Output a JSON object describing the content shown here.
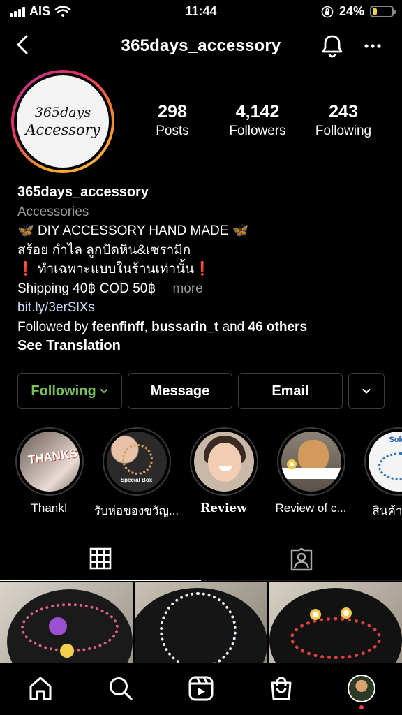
{
  "status_bar": {
    "carrier": "AIS",
    "time": "11:44",
    "battery_percent": "24%",
    "battery_level": 0.24,
    "icons": [
      "signal-icon",
      "wifi-icon",
      "orientation-lock-icon",
      "battery-icon"
    ]
  },
  "header": {
    "title": "365days_accessory",
    "icons": [
      "back-arrow-icon",
      "bell-icon",
      "more-dots-icon"
    ]
  },
  "profile": {
    "avatar_line1": "365days",
    "avatar_line2": "Accessory",
    "stats": [
      {
        "value": "298",
        "label": "Posts"
      },
      {
        "value": "4,142",
        "label": "Followers"
      },
      {
        "value": "243",
        "label": "Following"
      }
    ]
  },
  "bio": {
    "name": "365days_accessory",
    "category": "Accessories",
    "line1": "DIY ACCESSORY HAND MADE",
    "line2": "สร้อย กำไล ลูกปัดหิน&เซรามิก",
    "line3": "ทำเฉพาะแบบในร้านเท่านั้น",
    "line4": "Shipping 40฿ COD 50฿",
    "more": "more",
    "link": "bit.ly/3erSlXs",
    "followed_by_prefix": "Followed by ",
    "followed_user1": "feenfinff",
    "followed_sep": ", ",
    "followed_user2": "bussarin_t",
    "followed_and": " and ",
    "followed_others": "46 others",
    "see_translation": "See Translation",
    "butterfly_glyph": "🦋",
    "exclamation_glyph": "❗"
  },
  "buttons": {
    "following": "Following",
    "message": "Message",
    "email": "Email",
    "following_color": "#78c257"
  },
  "highlights": [
    {
      "label": "Thank!",
      "image_text": "THANKS!"
    },
    {
      "label": "รับห่อของขวัญ...",
      "image_text": "Special Box"
    },
    {
      "label": "Review",
      "image_text": ""
    },
    {
      "label": "Review of c...",
      "image_text": ""
    },
    {
      "label": "สินค้าขาย",
      "image_text": "Sold out"
    }
  ],
  "tabs": {
    "icons": [
      "grid-icon",
      "tagged-icon"
    ],
    "active": "grid"
  },
  "bottom_nav": {
    "icons": [
      "home-icon",
      "search-icon",
      "reels-icon",
      "shop-icon",
      "profile-avatar"
    ]
  },
  "colors": {
    "background": "#000000",
    "link": "#c7d9f5",
    "secondary_text": "#9a9a9a",
    "notification_dot": "#ff3b5c"
  }
}
